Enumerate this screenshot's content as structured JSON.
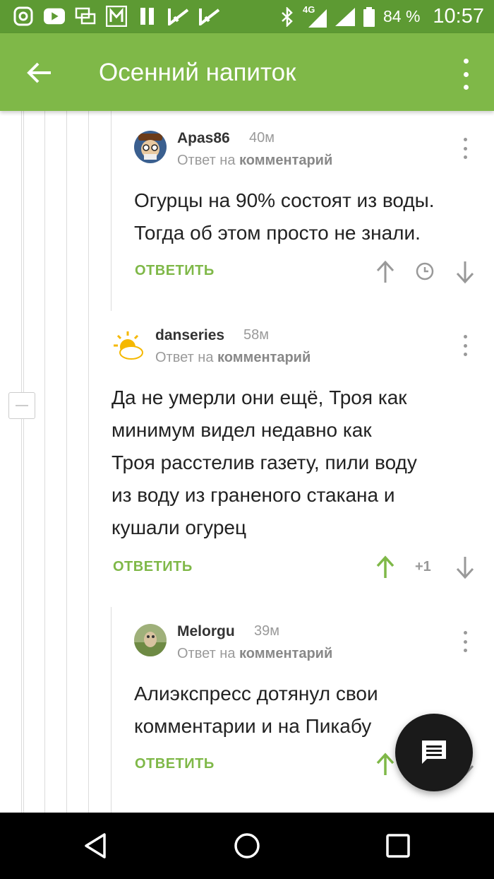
{
  "status_bar": {
    "network": "4G",
    "battery": "84 %",
    "time": "10:57"
  },
  "app_bar": {
    "title": "Осенний напиток"
  },
  "comments": [
    {
      "author": "Apas86",
      "time": "40м",
      "reply_prefix": "Ответ на",
      "reply_target": "комментарий",
      "text_lines": [
        "Огурцы на 90% состоят из воды.",
        "Тогда об этом просто не знали."
      ],
      "reply_label": "ОТВЕТИТЬ"
    },
    {
      "author": "danseries",
      "time": "58м",
      "reply_prefix": "Ответ на",
      "reply_target": "комментарий",
      "text_lines": [
        "Да не умерли они ещё, Троя как",
        "минимум видел недавно как",
        "Троя расстелив газету, пили воду",
        "из воду из граненого стакана и",
        "кушали огурец"
      ],
      "reply_label": "ОТВЕТИТЬ",
      "rating": "+1"
    },
    {
      "author": "Melorgu",
      "time": "39м",
      "reply_prefix": "Ответ на",
      "reply_target": "комментарий",
      "text_lines": [
        "Алиэкспресс дотянул свои",
        "комментарии и на Пикабу"
      ],
      "reply_label": "ОТВЕТИТЬ"
    }
  ],
  "colors": {
    "status_bar": "#5d9a33",
    "app_bar": "#7fb848",
    "accent": "#7fb848",
    "upvoted": "#7fb848"
  },
  "icons": [
    "back-arrow-icon",
    "more-vert-icon",
    "upvote-icon",
    "downvote-icon",
    "clock-icon",
    "comment-fab-icon",
    "nav-back-icon",
    "nav-home-icon",
    "nav-recents-icon"
  ]
}
